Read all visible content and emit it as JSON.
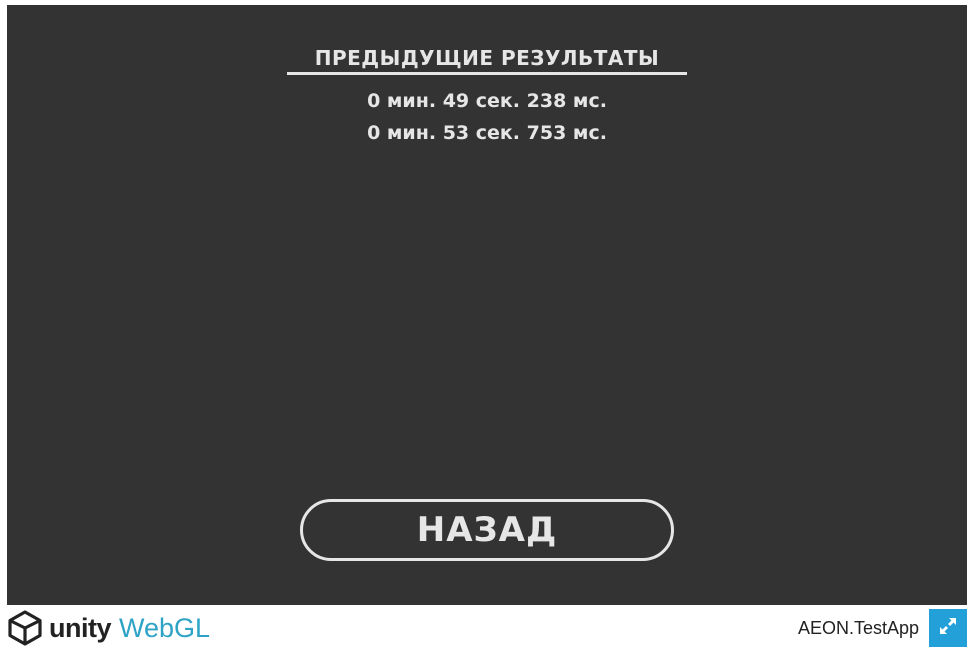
{
  "game": {
    "title": "ПРЕДЫДУЩИЕ РЕЗУЛЬТАТЫ",
    "results": [
      "0 мин. 49 сек. 238 мс.",
      "0 мин. 53 сек. 753 мс."
    ],
    "back_label": "НАЗАД"
  },
  "footer": {
    "logo_unity": "unity",
    "logo_webgl": "WebGL",
    "app_title": "AEON.TestApp",
    "fullscreen_icon": "fullscreen-icon"
  },
  "colors": {
    "canvas_bg": "#333333",
    "text": "#e6e6e6",
    "webgl_accent": "#2ea3c6",
    "fullscreen_bg": "#24a0d8"
  }
}
